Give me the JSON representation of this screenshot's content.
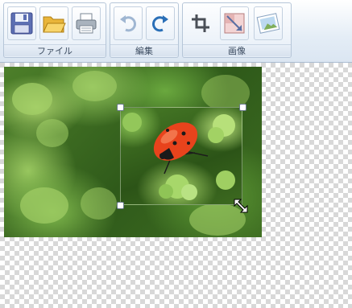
{
  "ribbon": {
    "groups": [
      {
        "label": "ファイル",
        "buttons": [
          "save",
          "open",
          "print"
        ]
      },
      {
        "label": "編集",
        "buttons": [
          "undo",
          "redo"
        ]
      },
      {
        "label": "画像",
        "buttons": [
          "crop",
          "resize",
          "edit-image"
        ]
      }
    ]
  },
  "icons": {
    "save": "floppy-disk-icon",
    "open": "folder-open-icon",
    "print": "printer-icon",
    "undo": "undo-arrow-icon",
    "redo": "redo-arrow-icon",
    "crop": "crop-icon",
    "resize": "resize-image-icon",
    "edit_image": "image-edit-icon",
    "cursor": "diagonal-resize-cursor-icon"
  },
  "colors": {
    "ribbon_border": "#aabbd0",
    "accent_blue": "#2a6fb7",
    "ladybug_red": "#e8431c"
  }
}
